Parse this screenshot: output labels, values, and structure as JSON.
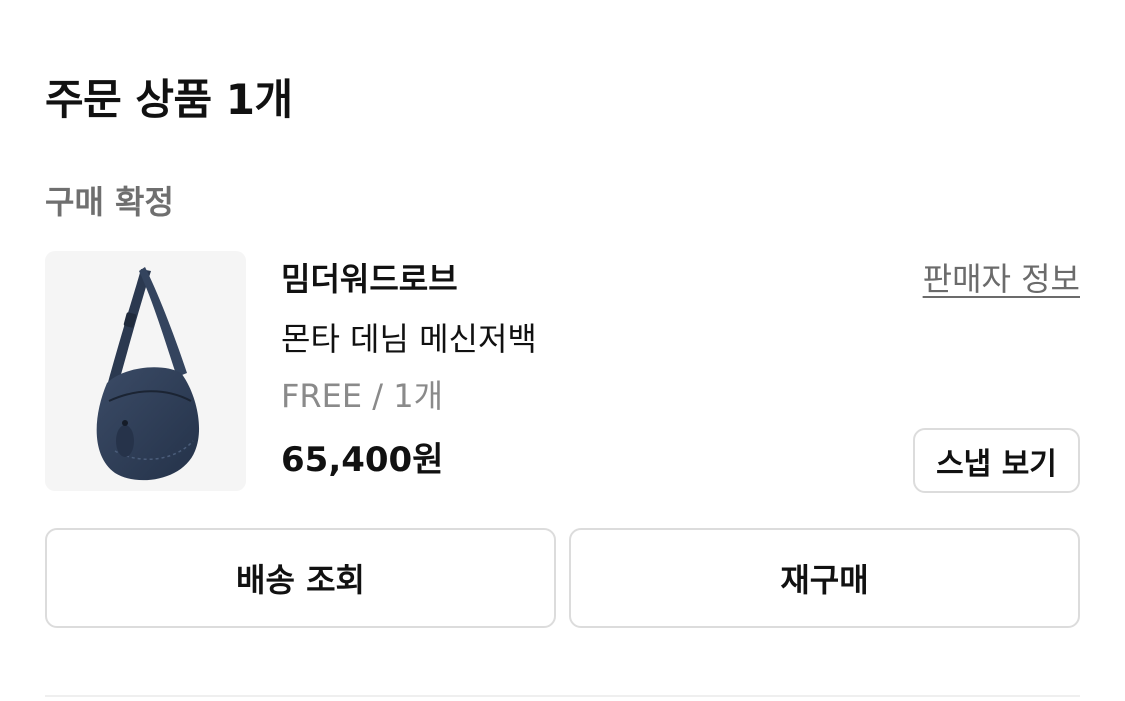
{
  "order": {
    "section_title": "주문 상품 1개",
    "status": "구매 확정"
  },
  "product": {
    "image_icon": "denim-messenger-bag-image",
    "brand": "밈더워드로브",
    "seller_link_label": "판매자 정보",
    "name": "몬타 데님 메신저백",
    "option": "FREE / 1개",
    "price": "65,400원",
    "snap_button_label": "스냅 보기"
  },
  "actions": {
    "track_shipping_label": "배송 조회",
    "reorder_label": "재구매"
  },
  "colors": {
    "text_primary": "#111111",
    "text_secondary": "#6f6f6f",
    "border": "#dcdcdc",
    "thumbnail_bg": "#f5f5f5",
    "bag_denim": "#2f3e57"
  }
}
